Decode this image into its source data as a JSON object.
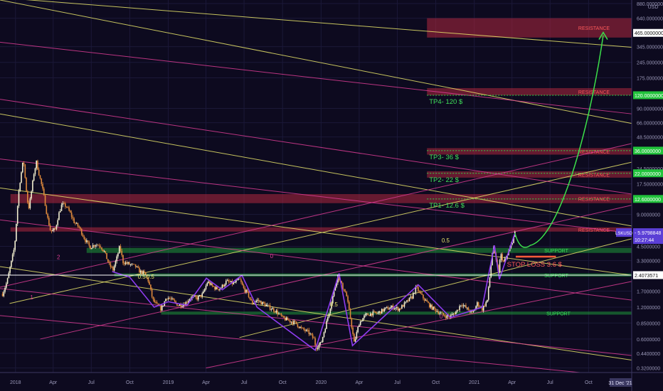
{
  "chart_data": {
    "type": "candlestick",
    "symbol": "LSKUSD",
    "currency": "USD",
    "scale": "log",
    "grid": true,
    "ylim": [
      0.29,
      950
    ],
    "xlim": [
      "2017-11-25",
      "2022-01-12"
    ],
    "x_ticks": [
      {
        "date": "2018-01-01",
        "label": "2018"
      },
      {
        "date": "2018-04-01",
        "label": "Apr"
      },
      {
        "date": "2018-07-01",
        "label": "Jul"
      },
      {
        "date": "2018-10-01",
        "label": "Oct"
      },
      {
        "date": "2019-01-01",
        "label": "2019"
      },
      {
        "date": "2019-04-01",
        "label": "Apr"
      },
      {
        "date": "2019-07-01",
        "label": "Jul"
      },
      {
        "date": "2019-10-01",
        "label": "Oct"
      },
      {
        "date": "2020-01-01",
        "label": "2020"
      },
      {
        "date": "2020-04-01",
        "label": "Apr"
      },
      {
        "date": "2020-07-01",
        "label": "Jul"
      },
      {
        "date": "2020-10-01",
        "label": "Oct"
      },
      {
        "date": "2021-01-01",
        "label": "2021"
      },
      {
        "date": "2021-04-01",
        "label": "Apr"
      },
      {
        "date": "2021-07-01",
        "label": "Jul"
      },
      {
        "date": "2021-10-01",
        "label": "Oct"
      }
    ],
    "x_end_label": "31 Dec '21",
    "y_ticks": [
      {
        "value": 880,
        "label": "880.0000000"
      },
      {
        "value": 640,
        "label": "640.0000000"
      },
      {
        "value": 345,
        "label": "345.0000000"
      },
      {
        "value": 245,
        "label": "245.0000000"
      },
      {
        "value": 175,
        "label": "175.0000000"
      },
      {
        "value": 90,
        "label": "90.0000000"
      },
      {
        "value": 66,
        "label": "66.0000000"
      },
      {
        "value": 48.5,
        "label": "48.5000000"
      },
      {
        "value": 24.5,
        "label": "24.5000000"
      },
      {
        "value": 17.5,
        "label": "17.5000000"
      },
      {
        "value": 9,
        "label": "9.0000000"
      },
      {
        "value": 4.5,
        "label": "4.5000000"
      },
      {
        "value": 3.3,
        "label": "3.3000000"
      },
      {
        "value": 1.7,
        "label": "1.7000000"
      },
      {
        "value": 1.2,
        "label": "1.2000000"
      },
      {
        "value": 0.85,
        "label": "0.8500000"
      },
      {
        "value": 0.6,
        "label": "0.6000000"
      },
      {
        "value": 0.44,
        "label": "0.4400000"
      },
      {
        "value": 0.32,
        "label": "0.3200000"
      }
    ],
    "price_tags": [
      {
        "value": 465,
        "label": "465.0000000",
        "style": "white"
      },
      {
        "value": 120,
        "label": "120.0000000",
        "style": "green"
      },
      {
        "value": 36,
        "label": "36.0000000",
        "style": "green"
      },
      {
        "value": 22,
        "label": "22.0000000",
        "style": "green"
      },
      {
        "value": 12.6,
        "label": "12.6000000",
        "style": "green"
      },
      {
        "value": 2.4073571,
        "label": "2.4073571",
        "style": "white"
      }
    ],
    "last_price": {
      "symbol": "LSKUSD",
      "value": 5.9798848,
      "label": "5.9798848",
      "countdown": "10:27:44"
    },
    "price_path": [
      [
        "2017-12-01",
        1.6
      ],
      [
        "2017-12-12",
        2.1
      ],
      [
        "2017-12-22",
        3.2
      ],
      [
        "2017-12-30",
        4.5
      ],
      [
        "2018-01-08",
        14
      ],
      [
        "2018-01-13",
        20
      ],
      [
        "2018-01-20",
        30
      ],
      [
        "2018-01-25",
        18
      ],
      [
        "2018-02-01",
        10
      ],
      [
        "2018-02-06",
        13
      ],
      [
        "2018-02-14",
        22
      ],
      [
        "2018-02-20",
        28
      ],
      [
        "2018-02-27",
        21
      ],
      [
        "2018-03-06",
        16
      ],
      [
        "2018-03-12",
        12
      ],
      [
        "2018-03-18",
        8.5
      ],
      [
        "2018-03-26",
        6.2
      ],
      [
        "2018-04-06",
        6.5
      ],
      [
        "2018-04-14",
        9
      ],
      [
        "2018-04-22",
        11.2
      ],
      [
        "2018-05-02",
        10.8
      ],
      [
        "2018-05-12",
        9.2
      ],
      [
        "2018-05-22",
        7.5
      ],
      [
        "2018-06-02",
        6.8
      ],
      [
        "2018-06-15",
        5.3
      ],
      [
        "2018-06-28",
        4.4
      ],
      [
        "2018-07-10",
        4.7
      ],
      [
        "2018-07-22",
        4.6
      ],
      [
        "2018-08-01",
        4.0
      ],
      [
        "2018-08-13",
        3.0
      ],
      [
        "2018-08-22",
        2.7
      ],
      [
        "2018-09-01",
        3.6
      ],
      [
        "2018-09-07",
        4.5
      ],
      [
        "2018-09-15",
        3.2
      ],
      [
        "2018-09-25",
        3.1
      ],
      [
        "2018-10-05",
        3.0
      ],
      [
        "2018-10-15",
        2.9
      ],
      [
        "2018-10-25",
        2.6
      ],
      [
        "2018-11-05",
        2.5
      ],
      [
        "2018-11-15",
        2.1
      ],
      [
        "2018-11-25",
        1.4
      ],
      [
        "2018-12-05",
        1.25
      ],
      [
        "2018-12-15",
        1.15
      ],
      [
        "2018-12-28",
        1.5
      ],
      [
        "2019-01-10",
        1.4
      ],
      [
        "2019-01-25",
        1.25
      ],
      [
        "2019-02-10",
        1.3
      ],
      [
        "2019-02-25",
        1.5
      ],
      [
        "2019-03-10",
        1.45
      ],
      [
        "2019-03-25",
        1.6
      ],
      [
        "2019-04-05",
        2.1
      ],
      [
        "2019-04-15",
        1.9
      ],
      [
        "2019-04-25",
        1.8
      ],
      [
        "2019-05-05",
        1.8
      ],
      [
        "2019-05-20",
        2.1
      ],
      [
        "2019-06-05",
        2.0
      ],
      [
        "2019-06-20",
        2.2
      ],
      [
        "2019-06-30",
        1.8
      ],
      [
        "2019-07-10",
        1.6
      ],
      [
        "2019-07-20",
        1.3
      ],
      [
        "2019-08-01",
        1.4
      ],
      [
        "2019-08-15",
        1.3
      ],
      [
        "2019-08-30",
        1.2
      ],
      [
        "2019-09-15",
        1.1
      ],
      [
        "2019-10-01",
        0.95
      ],
      [
        "2019-10-15",
        0.9
      ],
      [
        "2019-11-01",
        0.85
      ],
      [
        "2019-11-15",
        0.75
      ],
      [
        "2019-12-01",
        0.7
      ],
      [
        "2019-12-15",
        0.6
      ],
      [
        "2019-12-20",
        0.5
      ],
      [
        "2020-01-01",
        0.55
      ],
      [
        "2020-01-15",
        0.9
      ],
      [
        "2020-01-25",
        1.3
      ],
      [
        "2020-02-10",
        2.4
      ],
      [
        "2020-02-20",
        1.9
      ],
      [
        "2020-03-01",
        1.6
      ],
      [
        "2020-03-12",
        0.9
      ],
      [
        "2020-03-20",
        0.55
      ],
      [
        "2020-04-01",
        0.85
      ],
      [
        "2020-04-15",
        1.0
      ],
      [
        "2020-05-01",
        1.05
      ],
      [
        "2020-05-15",
        1.05
      ],
      [
        "2020-06-01",
        1.15
      ],
      [
        "2020-06-20",
        1.2
      ],
      [
        "2020-07-05",
        1.15
      ],
      [
        "2020-07-20",
        1.3
      ],
      [
        "2020-08-05",
        1.5
      ],
      [
        "2020-08-15",
        1.85
      ],
      [
        "2020-08-25",
        1.6
      ],
      [
        "2020-09-05",
        1.4
      ],
      [
        "2020-09-20",
        1.2
      ],
      [
        "2020-10-05",
        1.1
      ],
      [
        "2020-10-20",
        1.0
      ],
      [
        "2020-11-05",
        0.98
      ],
      [
        "2020-11-20",
        1.1
      ],
      [
        "2020-12-01",
        1.3
      ],
      [
        "2020-12-15",
        1.15
      ],
      [
        "2020-12-28",
        1.05
      ],
      [
        "2021-01-08",
        1.3
      ],
      [
        "2021-01-20",
        1.15
      ],
      [
        "2021-02-01",
        1.4
      ],
      [
        "2021-02-08",
        2.5
      ],
      [
        "2021-02-15",
        4.7
      ],
      [
        "2021-02-20",
        3.5
      ],
      [
        "2021-02-28",
        2.6
      ],
      [
        "2021-03-05",
        3.8
      ],
      [
        "2021-03-12",
        3.2
      ],
      [
        "2021-03-20",
        3.6
      ],
      [
        "2021-03-28",
        4.4
      ],
      [
        "2021-04-03",
        5.2
      ],
      [
        "2021-04-08",
        5.98
      ]
    ],
    "wave_path": [
      [
        "2018-08-20",
        2.6
      ],
      [
        "2018-10-01",
        2.3
      ],
      [
        "2018-11-28",
        1.2
      ],
      [
        "2019-01-01",
        1.35
      ],
      [
        "2019-02-15",
        1.25
      ],
      [
        "2019-04-02",
        2.25
      ],
      [
        "2019-05-10",
        1.75
      ],
      [
        "2019-06-26",
        2.4
      ],
      [
        "2019-08-01",
        1.2
      ],
      [
        "2019-12-18",
        0.47
      ],
      [
        "2020-02-13",
        2.5
      ],
      [
        "2020-03-16",
        0.52
      ],
      [
        "2020-08-20",
        1.95
      ],
      [
        "2020-11-05",
        0.96
      ],
      [
        "2021-01-20",
        1.2
      ],
      [
        "2021-02-18",
        4.6
      ],
      [
        "2021-03-02",
        2.2
      ],
      [
        "2021-04-08",
        5.98
      ]
    ],
    "zones": [
      {
        "label": "RESISTANCE",
        "kind": "resistance",
        "from": "2020-09-10",
        "ylow": 420,
        "yhigh": 640
      },
      {
        "label": "RESISTANCE",
        "kind": "resistance",
        "from": "2020-09-10",
        "ylow": 120,
        "yhigh": 140
      },
      {
        "label": "RESISTANCE",
        "kind": "resistance",
        "from": "2020-09-10",
        "ylow": 33,
        "yhigh": 38
      },
      {
        "label": "RESISTANCE",
        "kind": "resistance",
        "from": "2020-09-10",
        "ylow": 20,
        "yhigh": 23
      },
      {
        "label": "RESISTANCE",
        "kind": "resistance",
        "from": "2017-12-20",
        "ylow": 11.5,
        "yhigh": 14
      },
      {
        "label": "RESISTANCE",
        "kind": "resistance",
        "from": "2017-12-20",
        "ylow": 6.2,
        "yhigh": 6.8
      },
      {
        "label": "SUPPORT",
        "kind": "support",
        "from": "2018-06-20",
        "ylow": 3.9,
        "yhigh": 4.35
      },
      {
        "label": "SUPPORT",
        "kind": "support",
        "from": "2018-08-25",
        "ylow": 2.33,
        "yhigh": 2.5
      },
      {
        "label": "SUPPORT",
        "kind": "support",
        "from": "2018-12-15",
        "ylow": 1.02,
        "yhigh": 1.09
      }
    ],
    "targets": [
      {
        "label": "TP4- 120 $",
        "value": 120
      },
      {
        "label": "TP3- 36 $",
        "value": 36
      },
      {
        "label": "TP2- 22 $",
        "value": 22
      },
      {
        "label": "TP1- 12.6 $",
        "value": 12.6
      }
    ],
    "stop_loss": {
      "label": "STOP LOSS 3.6 $",
      "value": 3.6
    },
    "horizontal_line": {
      "value": 2.4073571
    },
    "projection": {
      "from": [
        "2021-04-08",
        5.98
      ],
      "mid": [
        "2021-05-15",
        4.6
      ],
      "to": [
        "2021-11-05",
        470
      ]
    },
    "channel_labels": [
      {
        "label": "0.5",
        "at": [
          "2020-10-15",
          4.9
        ]
      },
      {
        "label": "0.5",
        "at": [
          "2018-10-20",
          2.22
        ]
      },
      {
        "label": "-0.5",
        "at": [
          "2018-11-05",
          2.22
        ]
      },
      {
        "label": "0.5",
        "at": [
          "2020-01-22",
          1.22
        ]
      },
      {
        "label": "0",
        "at": [
          "2019-09-01",
          3.5
        ]
      },
      {
        "label": "2",
        "at": [
          "2018-04-10",
          3.4
        ]
      },
      {
        "label": "0",
        "at": [
          "2020-10-10",
          0.94
        ]
      },
      {
        "label": "1",
        "at": [
          "2018-02-05",
          1.42
        ]
      }
    ],
    "channels": [
      {
        "color": "#e8e46a",
        "from": [
          "2017-11-25",
          1000
        ],
        "to": [
          "2022-01-12",
          340
        ]
      },
      {
        "color": "#e8e46a",
        "from": [
          "2017-11-25",
          950
        ],
        "to": [
          "2022-01-12",
          65
        ]
      },
      {
        "color": "#e8e46a",
        "from": [
          "2017-11-25",
          80
        ],
        "to": [
          "2022-01-12",
          7
        ]
      },
      {
        "color": "#e8e46a",
        "from": [
          "2017-11-25",
          16
        ],
        "to": [
          "2022-01-12",
          2.4
        ]
      },
      {
        "color": "#e8e46a",
        "from": [
          "2017-11-25",
          2.9
        ],
        "to": [
          "2022-01-12",
          0.38
        ]
      },
      {
        "color": "#e8e46a",
        "from": [
          "2017-12-18",
          1.3
        ],
        "to": [
          "2022-01-12",
          28
        ]
      },
      {
        "color": "#e8e46a",
        "from": [
          "2019-06-20",
          0.62
        ],
        "to": [
          "2022-01-12",
          5.3
        ]
      },
      {
        "color": "#d93c93",
        "from": [
          "2017-11-25",
          380
        ],
        "to": [
          "2022-01-12",
          80
        ]
      },
      {
        "color": "#d93c93",
        "from": [
          "2017-11-25",
          110
        ],
        "to": [
          "2022-01-12",
          14
        ]
      },
      {
        "color": "#d93c93",
        "from": [
          "2017-11-25",
          30
        ],
        "to": [
          "2022-01-12",
          6
        ]
      },
      {
        "color": "#d93c93",
        "from": [
          "2017-11-25",
          8
        ],
        "to": [
          "2022-01-12",
          1.4
        ]
      },
      {
        "color": "#d93c93",
        "from": [
          "2017-11-25",
          1.8
        ],
        "to": [
          "2022-01-12",
          0.42
        ]
      },
      {
        "color": "#d93c93",
        "from": [
          "2017-11-25",
          1.0
        ],
        "to": [
          "2022-01-12",
          0.26
        ]
      },
      {
        "color": "#d93c93",
        "from": [
          "2017-11-25",
          1.85
        ],
        "to": [
          "2022-01-12",
          42
        ]
      },
      {
        "color": "#d93c93",
        "from": [
          "2018-03-01",
          0.6
        ],
        "to": [
          "2022-01-12",
          11
        ]
      },
      {
        "color": "#d93c93",
        "from": [
          "2019-04-01",
          0.32
        ],
        "to": [
          "2022-01-12",
          2.1
        ]
      }
    ]
  }
}
